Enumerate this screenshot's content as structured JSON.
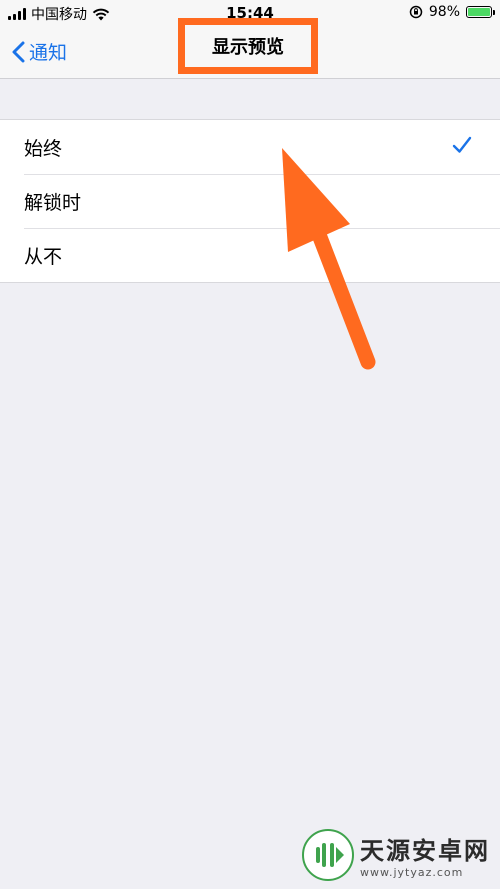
{
  "status_bar": {
    "carrier": "中国移动",
    "time": "15:44",
    "battery_percent": "98%"
  },
  "nav": {
    "back_label": "通知",
    "title": "显示预览"
  },
  "options": [
    {
      "label": "始终",
      "selected": true
    },
    {
      "label": "解锁时",
      "selected": false
    },
    {
      "label": "从不",
      "selected": false
    }
  ],
  "colors": {
    "accent": "#1a73e8",
    "annotation": "#ff6a1f",
    "background": "#efeff4"
  },
  "watermark": {
    "name": "天源安卓网",
    "url": "www.jytyaz.com"
  }
}
